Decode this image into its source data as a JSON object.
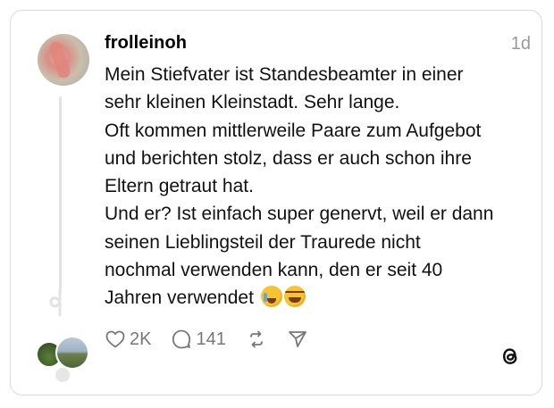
{
  "post": {
    "username": "frolleinoh",
    "time": "1d",
    "lines": [
      "Mein Stiefvater ist Standesbeamter in einer",
      "sehr kleinen Kleinstadt. Sehr lange.",
      "Oft kommen mittlerweile Paare zum Aufgebot",
      "und berichten stolz, dass er auch schon ihre",
      "Eltern getraut hat.",
      "Und er? Ist einfach super genervt, weil er dann",
      "seinen Lieblingsteil der Traurede nicht",
      "nochmal verwenden kann, den er seit 40",
      "Jahren verwendet"
    ],
    "emojis": [
      "crying-face-emoji",
      "laughing-face-emoji"
    ]
  },
  "actions": {
    "likes": "2K",
    "replies": "141"
  },
  "icons": {
    "like": "heart-icon",
    "reply": "comment-icon",
    "repost": "repost-icon",
    "share": "send-icon",
    "brand": "threads-logo-icon"
  },
  "colors": {
    "muted": "#999999",
    "border": "#d9d9d9",
    "thread_line": "#e3e3e3"
  }
}
